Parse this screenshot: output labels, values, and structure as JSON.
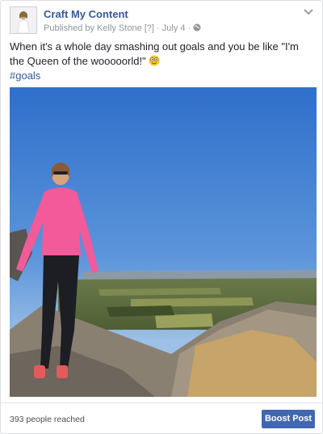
{
  "post": {
    "page_name": "Craft My Content",
    "published_by": "Published by Kelly Stone",
    "help_marker": "[?]",
    "separator": "·",
    "date": "July 4",
    "message": "When it's a whole day smashing out goals and you be like \"I'm the Queen of the wooooorld!\"",
    "emoji_icon": "smiling-face-emoji",
    "hashtag": "#goals",
    "audience_icon": "globe-icon"
  },
  "footer": {
    "reach": "393 people reached",
    "boost_label": "Boost Post"
  },
  "colors": {
    "link": "#365899",
    "boost": "#4267b2",
    "sky": "#3f7fd0"
  }
}
